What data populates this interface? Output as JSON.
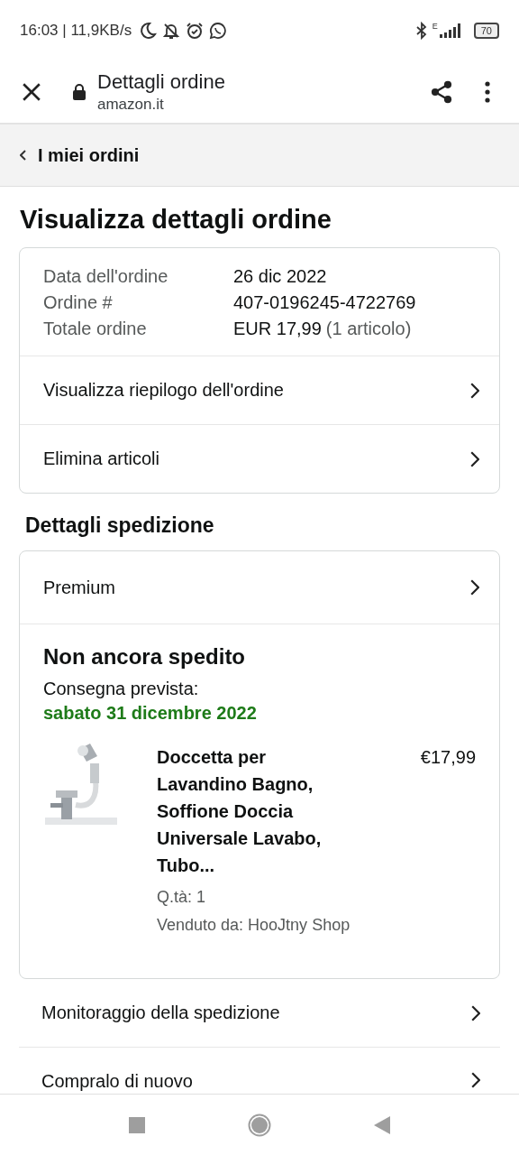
{
  "status_bar": {
    "time": "16:03 | 11,9KB/s",
    "network": "E",
    "battery": "70"
  },
  "browser_bar": {
    "title": "Dettagli ordine",
    "domain": "amazon.it"
  },
  "breadcrumb": {
    "label": "I miei ordini"
  },
  "page_title": "Visualizza dettagli ordine",
  "order_summary": [
    {
      "label": "Data dell'ordine",
      "value": "26 dic 2022"
    },
    {
      "label": "Ordine #",
      "value": "407-0196245-4722769"
    },
    {
      "label": "Totale ordine",
      "value": "EUR 17,99",
      "note": "(1 articolo)"
    }
  ],
  "order_links": [
    "Visualizza riepilogo dell'ordine",
    "Elimina articoli"
  ],
  "shipping": {
    "heading": "Dettagli spedizione",
    "method": "Premium",
    "status": "Non ancora spedito",
    "delivery_label": "Consegna prevista:",
    "delivery_date": "sabato 31 dicembre 2022",
    "item": {
      "title": "Doccetta per Lavandino Bagno, Soffione Doccia Universale Lavabo, Tubo...",
      "price": "€17,99",
      "quantity": "Q.tà: 1",
      "seller": "Venduto da: HooJtny Shop"
    }
  },
  "actions": [
    "Monitoraggio della spedizione",
    "Compralo di nuovo"
  ]
}
